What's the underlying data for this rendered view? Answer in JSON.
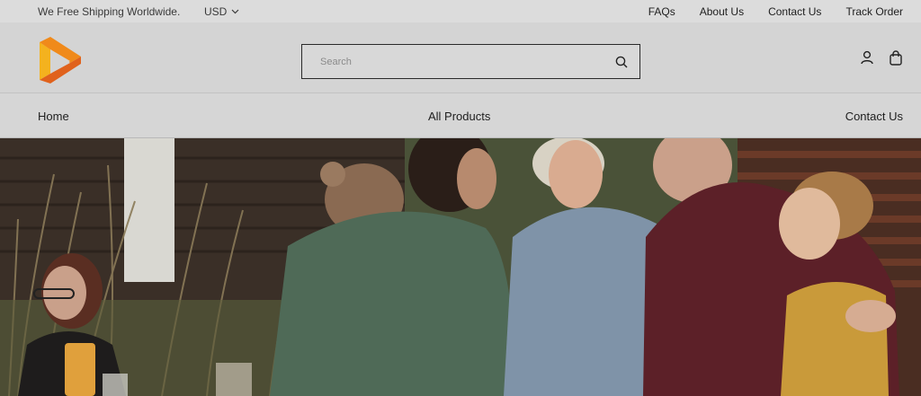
{
  "topbar": {
    "shipping_text": "We Free Shipping Worldwide.",
    "currency": "USD",
    "links": [
      "FAQs",
      "About Us",
      "Contact Us",
      "Track Order"
    ]
  },
  "header": {
    "search": {
      "placeholder": "Search"
    },
    "icons": [
      "account-icon",
      "cart-bag-icon"
    ]
  },
  "nav": {
    "items": [
      "Home",
      "All Products",
      "Contact Us"
    ]
  },
  "colors": {
    "logo_orange": "#f08a1a",
    "logo_dark_orange": "#e0621c",
    "logo_yellow": "#f4b21e"
  }
}
